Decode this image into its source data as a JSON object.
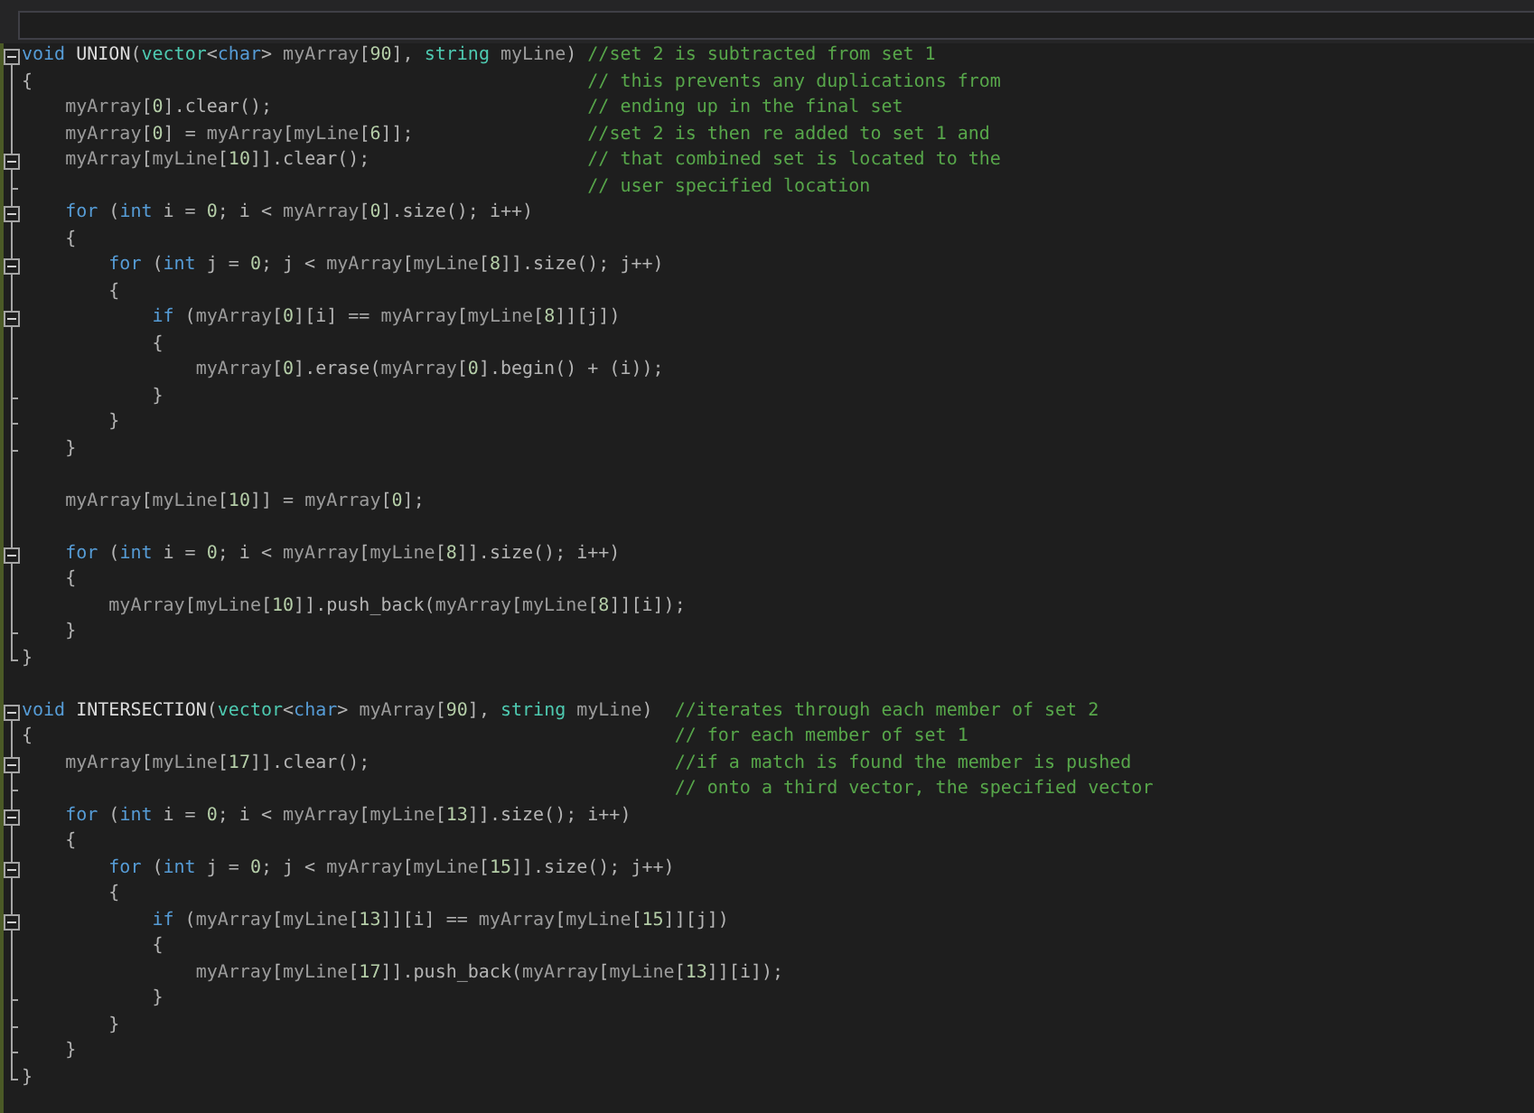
{
  "functions": [
    {
      "lines": [
        {
          "collapsible": true,
          "comment": "//set 2 is subtracted from set 1",
          "tokens": [
            {
              "text": "void",
              "kind": "kw",
              "space_after": true
            },
            {
              "text": "UNION",
              "kind": "fn"
            },
            {
              "text": "(",
              "kind": "op"
            },
            {
              "text": "vector",
              "kind": "type"
            },
            {
              "text": "<",
              "kind": "op"
            },
            {
              "text": "char",
              "kind": "kw"
            },
            {
              "text": "> ",
              "kind": "op"
            },
            {
              "text": "myArray",
              "kind": "param"
            },
            {
              "text": "[",
              "kind": "op"
            },
            {
              "text": "90",
              "kind": "num"
            },
            {
              "text": "], ",
              "kind": "op"
            },
            {
              "text": "string",
              "kind": "type",
              "space_after": true
            },
            {
              "text": "myLine",
              "kind": "param"
            },
            {
              "text": ")",
              "kind": "op"
            }
          ]
        },
        {
          "comment": "// this prevents any duplications from",
          "tokens": [
            {
              "text": "{",
              "kind": "op"
            }
          ],
          "children": [
            {
              "comment": "// ending up in the final set",
              "tokens": [
                {
                  "text": "myArray",
                  "kind": "param"
                },
                {
                  "text": "[",
                  "kind": "op"
                },
                {
                  "text": "0",
                  "kind": "num"
                },
                {
                  "text": "].clear();",
                  "kind": "op"
                }
              ]
            },
            {
              "comment": "//set 2 is then re added to set 1 and",
              "tokens": [
                {
                  "text": "myArray",
                  "kind": "param"
                },
                {
                  "text": "[",
                  "kind": "op"
                },
                {
                  "text": "0",
                  "kind": "num"
                },
                {
                  "text": "] = ",
                  "kind": "op"
                },
                {
                  "text": "myArray",
                  "kind": "param"
                },
                {
                  "text": "[",
                  "kind": "op"
                },
                {
                  "text": "myLine",
                  "kind": "param"
                },
                {
                  "text": "[",
                  "kind": "op"
                },
                {
                  "text": "6",
                  "kind": "num"
                },
                {
                  "text": "]];",
                  "kind": "op"
                }
              ]
            },
            {
              "collapsible": true,
              "comment": "// that combined set is located to the",
              "tokens": [
                {
                  "text": "myArray",
                  "kind": "param"
                },
                {
                  "text": "[",
                  "kind": "op"
                },
                {
                  "text": "myLine",
                  "kind": "param"
                },
                {
                  "text": "[",
                  "kind": "op"
                },
                {
                  "text": "10",
                  "kind": "num"
                },
                {
                  "text": "]].clear();",
                  "kind": "op"
                }
              ]
            },
            {
              "ends_block": true,
              "comment": "// user specified location"
            },
            {
              "collapsible": true,
              "tokens": [
                {
                  "text": "for",
                  "kind": "kw"
                },
                {
                  "text": " (",
                  "kind": "op"
                },
                {
                  "text": "int",
                  "kind": "kw"
                },
                {
                  "text": " i = ",
                  "kind": "op"
                },
                {
                  "text": "0",
                  "kind": "num"
                },
                {
                  "text": "; i < ",
                  "kind": "op"
                },
                {
                  "text": "myArray",
                  "kind": "param"
                },
                {
                  "text": "[",
                  "kind": "op"
                },
                {
                  "text": "0",
                  "kind": "num"
                },
                {
                  "text": "].size(); i++)",
                  "kind": "op"
                }
              ]
            },
            {
              "tokens": [
                {
                  "text": "{",
                  "kind": "op"
                }
              ],
              "children": [
                {
                  "collapsible": true,
                  "tokens": [
                    {
                      "text": "for",
                      "kind": "kw"
                    },
                    {
                      "text": " (",
                      "kind": "op"
                    },
                    {
                      "text": "int",
                      "kind": "kw"
                    },
                    {
                      "text": " j = ",
                      "kind": "op"
                    },
                    {
                      "text": "0",
                      "kind": "num"
                    },
                    {
                      "text": "; j < ",
                      "kind": "op"
                    },
                    {
                      "text": "myArray",
                      "kind": "param"
                    },
                    {
                      "text": "[",
                      "kind": "op"
                    },
                    {
                      "text": "myLine",
                      "kind": "param"
                    },
                    {
                      "text": "[",
                      "kind": "op"
                    },
                    {
                      "text": "8",
                      "kind": "num"
                    },
                    {
                      "text": "]].size(); j++)",
                      "kind": "op"
                    }
                  ]
                },
                {
                  "tokens": [
                    {
                      "text": "{",
                      "kind": "op"
                    }
                  ],
                  "children": [
                    {
                      "collapsible": true,
                      "tokens": [
                        {
                          "text": "if",
                          "kind": "kw"
                        },
                        {
                          "text": " (",
                          "kind": "op"
                        },
                        {
                          "text": "myArray",
                          "kind": "param"
                        },
                        {
                          "text": "[",
                          "kind": "op"
                        },
                        {
                          "text": "0",
                          "kind": "num"
                        },
                        {
                          "text": "][i] == ",
                          "kind": "op"
                        },
                        {
                          "text": "myArray",
                          "kind": "param"
                        },
                        {
                          "text": "[",
                          "kind": "op"
                        },
                        {
                          "text": "myLine",
                          "kind": "param"
                        },
                        {
                          "text": "[",
                          "kind": "op"
                        },
                        {
                          "text": "8",
                          "kind": "num"
                        },
                        {
                          "text": "]][j])",
                          "kind": "op"
                        }
                      ]
                    },
                    {
                      "tokens": [
                        {
                          "text": "{",
                          "kind": "op"
                        }
                      ],
                      "children": [
                        {
                          "tokens": [
                            {
                              "text": "myArray",
                              "kind": "param"
                            },
                            {
                              "text": "[",
                              "kind": "op"
                            },
                            {
                              "text": "0",
                              "kind": "num"
                            },
                            {
                              "text": "].erase(",
                              "kind": "op"
                            },
                            {
                              "text": "myArray",
                              "kind": "param"
                            },
                            {
                              "text": "[",
                              "kind": "op"
                            },
                            {
                              "text": "0",
                              "kind": "num"
                            },
                            {
                              "text": "].begin() + (i));",
                              "kind": "op"
                            }
                          ]
                        }
                      ]
                    },
                    {
                      "ends_block": true,
                      "tokens": [
                        {
                          "text": "}",
                          "kind": "op"
                        }
                      ]
                    }
                  ]
                },
                {
                  "ends_block": true,
                  "tokens": [
                    {
                      "text": "}",
                      "kind": "op"
                    }
                  ]
                }
              ]
            },
            {
              "ends_block": true,
              "tokens": [
                {
                  "text": "}",
                  "kind": "op"
                }
              ]
            },
            {
              "spaced": true,
              "tokens": [
                {
                  "text": "myArray",
                  "kind": "param"
                },
                {
                  "text": "[",
                  "kind": "op"
                },
                {
                  "text": "myLine",
                  "kind": "param"
                },
                {
                  "text": "[",
                  "kind": "op"
                },
                {
                  "text": "10",
                  "kind": "num"
                },
                {
                  "text": "]] = ",
                  "kind": "op"
                },
                {
                  "text": "myArray",
                  "kind": "param"
                },
                {
                  "text": "[",
                  "kind": "op"
                },
                {
                  "text": "0",
                  "kind": "num"
                },
                {
                  "text": "];",
                  "kind": "op"
                }
              ]
            },
            {
              "spaced": true,
              "collapsible": true,
              "tokens": [
                {
                  "text": "for",
                  "kind": "kw"
                },
                {
                  "text": " (",
                  "kind": "op"
                },
                {
                  "text": "int",
                  "kind": "kw"
                },
                {
                  "text": " i = ",
                  "kind": "op"
                },
                {
                  "text": "0",
                  "kind": "num"
                },
                {
                  "text": "; i < ",
                  "kind": "op"
                },
                {
                  "text": "myArray",
                  "kind": "param"
                },
                {
                  "text": "[",
                  "kind": "op"
                },
                {
                  "text": "myLine",
                  "kind": "param"
                },
                {
                  "text": "[",
                  "kind": "op"
                },
                {
                  "text": "8",
                  "kind": "num"
                },
                {
                  "text": "]].size(); i++)",
                  "kind": "op"
                }
              ]
            },
            {
              "tokens": [
                {
                  "text": "{",
                  "kind": "op"
                }
              ],
              "children": [
                {
                  "tokens": [
                    {
                      "text": "myArray",
                      "kind": "param"
                    },
                    {
                      "text": "[",
                      "kind": "op"
                    },
                    {
                      "text": "myLine",
                      "kind": "param"
                    },
                    {
                      "text": "[",
                      "kind": "op"
                    },
                    {
                      "text": "10",
                      "kind": "num"
                    },
                    {
                      "text": "]].push_back(",
                      "kind": "op"
                    },
                    {
                      "text": "myArray",
                      "kind": "param"
                    },
                    {
                      "text": "[",
                      "kind": "op"
                    },
                    {
                      "text": "myLine",
                      "kind": "param"
                    },
                    {
                      "text": "[",
                      "kind": "op"
                    },
                    {
                      "text": "8",
                      "kind": "num"
                    },
                    {
                      "text": "]][i]);",
                      "kind": "op"
                    }
                  ]
                }
              ]
            },
            {
              "ends_block": true,
              "tokens": [
                {
                  "text": "}",
                  "kind": "op"
                }
              ]
            }
          ]
        },
        {
          "ends_block": true,
          "tokens": [
            {
              "text": "}",
              "kind": "op"
            }
          ]
        }
      ]
    },
    {
      "lines": [
        {
          "collapsible": true,
          "comment": "//iterates through each member of set 2",
          "tokens": [
            {
              "text": "void",
              "kind": "kw",
              "space_after": true
            },
            {
              "text": "INTERSECTION",
              "kind": "fn"
            },
            {
              "text": "(",
              "kind": "op"
            },
            {
              "text": "vector",
              "kind": "type"
            },
            {
              "text": "<",
              "kind": "op"
            },
            {
              "text": "char",
              "kind": "kw"
            },
            {
              "text": "> ",
              "kind": "op"
            },
            {
              "text": "myArray",
              "kind": "param"
            },
            {
              "text": "[",
              "kind": "op"
            },
            {
              "text": "90",
              "kind": "num"
            },
            {
              "text": "], ",
              "kind": "op"
            },
            {
              "text": "string",
              "kind": "type",
              "space_after": true
            },
            {
              "text": "myLine",
              "kind": "param"
            },
            {
              "text": ")",
              "kind": "op"
            }
          ]
        },
        {
          "comment": "// for each member of set 1",
          "tokens": [
            {
              "text": "{",
              "kind": "op"
            }
          ],
          "children": [
            {
              "collapsible": true,
              "comment": "//if a match is found the member is pushed",
              "tokens": [
                {
                  "text": "myArray",
                  "kind": "param"
                },
                {
                  "text": "[",
                  "kind": "op"
                },
                {
                  "text": "myLine",
                  "kind": "param"
                },
                {
                  "text": "[",
                  "kind": "op"
                },
                {
                  "text": "17",
                  "kind": "num"
                },
                {
                  "text": "]].clear();",
                  "kind": "op"
                }
              ]
            },
            {
              "ends_block": true,
              "comment": "// onto a third vector, the specified vector"
            },
            {
              "collapsible": true,
              "tokens": [
                {
                  "text": "for",
                  "kind": "kw"
                },
                {
                  "text": " (",
                  "kind": "op"
                },
                {
                  "text": "int",
                  "kind": "kw"
                },
                {
                  "text": " i = ",
                  "kind": "op"
                },
                {
                  "text": "0",
                  "kind": "num"
                },
                {
                  "text": "; i < ",
                  "kind": "op"
                },
                {
                  "text": "myArray",
                  "kind": "param"
                },
                {
                  "text": "[",
                  "kind": "op"
                },
                {
                  "text": "myLine",
                  "kind": "param"
                },
                {
                  "text": "[",
                  "kind": "op"
                },
                {
                  "text": "13",
                  "kind": "num"
                },
                {
                  "text": "]].size(); i++)",
                  "kind": "op"
                }
              ]
            },
            {
              "tokens": [
                {
                  "text": "{",
                  "kind": "op"
                }
              ],
              "children": [
                {
                  "collapsible": true,
                  "tokens": [
                    {
                      "text": "for",
                      "kind": "kw"
                    },
                    {
                      "text": " (",
                      "kind": "op"
                    },
                    {
                      "text": "int",
                      "kind": "kw"
                    },
                    {
                      "text": " j = ",
                      "kind": "op"
                    },
                    {
                      "text": "0",
                      "kind": "num"
                    },
                    {
                      "text": "; j < ",
                      "kind": "op"
                    },
                    {
                      "text": "myArray",
                      "kind": "param"
                    },
                    {
                      "text": "[",
                      "kind": "op"
                    },
                    {
                      "text": "myLine",
                      "kind": "param"
                    },
                    {
                      "text": "[",
                      "kind": "op"
                    },
                    {
                      "text": "15",
                      "kind": "num"
                    },
                    {
                      "text": "]].size(); j++)",
                      "kind": "op"
                    }
                  ]
                },
                {
                  "tokens": [
                    {
                      "text": "{",
                      "kind": "op"
                    }
                  ],
                  "children": [
                    {
                      "collapsible": true,
                      "tokens": [
                        {
                          "text": "if",
                          "kind": "kw"
                        },
                        {
                          "text": " (",
                          "kind": "op"
                        },
                        {
                          "text": "myArray",
                          "kind": "param"
                        },
                        {
                          "text": "[",
                          "kind": "op"
                        },
                        {
                          "text": "myLine",
                          "kind": "param"
                        },
                        {
                          "text": "[",
                          "kind": "op"
                        },
                        {
                          "text": "13",
                          "kind": "num"
                        },
                        {
                          "text": "]][i] == ",
                          "kind": "op"
                        },
                        {
                          "text": "myArray",
                          "kind": "param"
                        },
                        {
                          "text": "[",
                          "kind": "op"
                        },
                        {
                          "text": "myLine",
                          "kind": "param"
                        },
                        {
                          "text": "[",
                          "kind": "op"
                        },
                        {
                          "text": "15",
                          "kind": "num"
                        },
                        {
                          "text": "]][j])",
                          "kind": "op"
                        }
                      ]
                    },
                    {
                      "tokens": [
                        {
                          "text": "{",
                          "kind": "op"
                        }
                      ],
                      "children": [
                        {
                          "tokens": [
                            {
                              "text": "myArray",
                              "kind": "param"
                            },
                            {
                              "text": "[",
                              "kind": "op"
                            },
                            {
                              "text": "myLine",
                              "kind": "param"
                            },
                            {
                              "text": "[",
                              "kind": "op"
                            },
                            {
                              "text": "17",
                              "kind": "num"
                            },
                            {
                              "text": "]].push_back(",
                              "kind": "op"
                            },
                            {
                              "text": "myArray",
                              "kind": "param"
                            },
                            {
                              "text": "[",
                              "kind": "op"
                            },
                            {
                              "text": "myLine",
                              "kind": "param"
                            },
                            {
                              "text": "[",
                              "kind": "op"
                            },
                            {
                              "text": "13",
                              "kind": "num"
                            },
                            {
                              "text": "]][i]);",
                              "kind": "op"
                            }
                          ]
                        }
                      ]
                    },
                    {
                      "ends_block": true,
                      "tokens": [
                        {
                          "text": "}",
                          "kind": "op"
                        }
                      ]
                    }
                  ]
                },
                {
                  "ends_block": true,
                  "tokens": [
                    {
                      "text": "}",
                      "kind": "op"
                    }
                  ]
                }
              ]
            },
            {
              "ends_block": true,
              "tokens": [
                {
                  "text": "}",
                  "kind": "op"
                }
              ]
            }
          ]
        },
        {
          "ends_block": true,
          "tokens": [
            {
              "text": "}",
              "kind": "op"
            }
          ]
        }
      ]
    }
  ]
}
